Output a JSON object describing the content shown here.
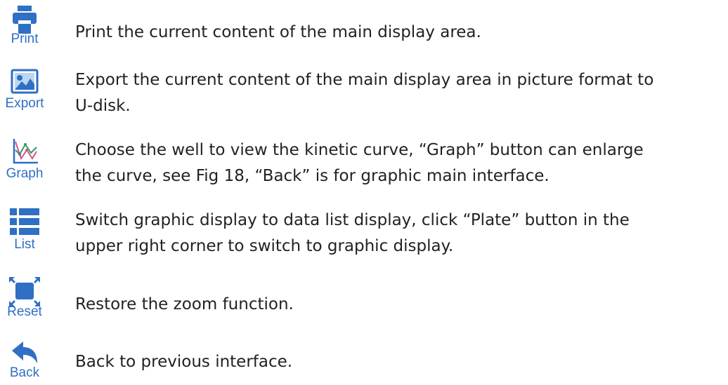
{
  "colors": {
    "icon_blue": "#2f6fc4",
    "text": "#222222"
  },
  "items": [
    {
      "icon": "printer-icon",
      "label": "Print",
      "lines": [
        "Print the current content of the main display area."
      ]
    },
    {
      "icon": "picture-icon",
      "label": "Export",
      "lines": [
        "Export the current content of the main display area in picture format to",
        "U-disk."
      ]
    },
    {
      "icon": "curve-chart-icon",
      "label": "Graph",
      "lines": [
        "Choose the well to view the kinetic curve, “Graph” button can enlarge",
        "the curve, see Fig 18, “Back” is for graphic main interface."
      ]
    },
    {
      "icon": "list-icon",
      "label": "List",
      "lines": [
        "Switch graphic display to data list display, click “Plate” button in the",
        "upper right corner to switch to graphic display."
      ]
    },
    {
      "icon": "reset-zoom-icon",
      "label": "Reset",
      "lines": [
        "Restore the zoom function."
      ]
    },
    {
      "icon": "back-arrow-icon",
      "label": "Back",
      "lines": [
        "Back to previous interface."
      ]
    }
  ]
}
